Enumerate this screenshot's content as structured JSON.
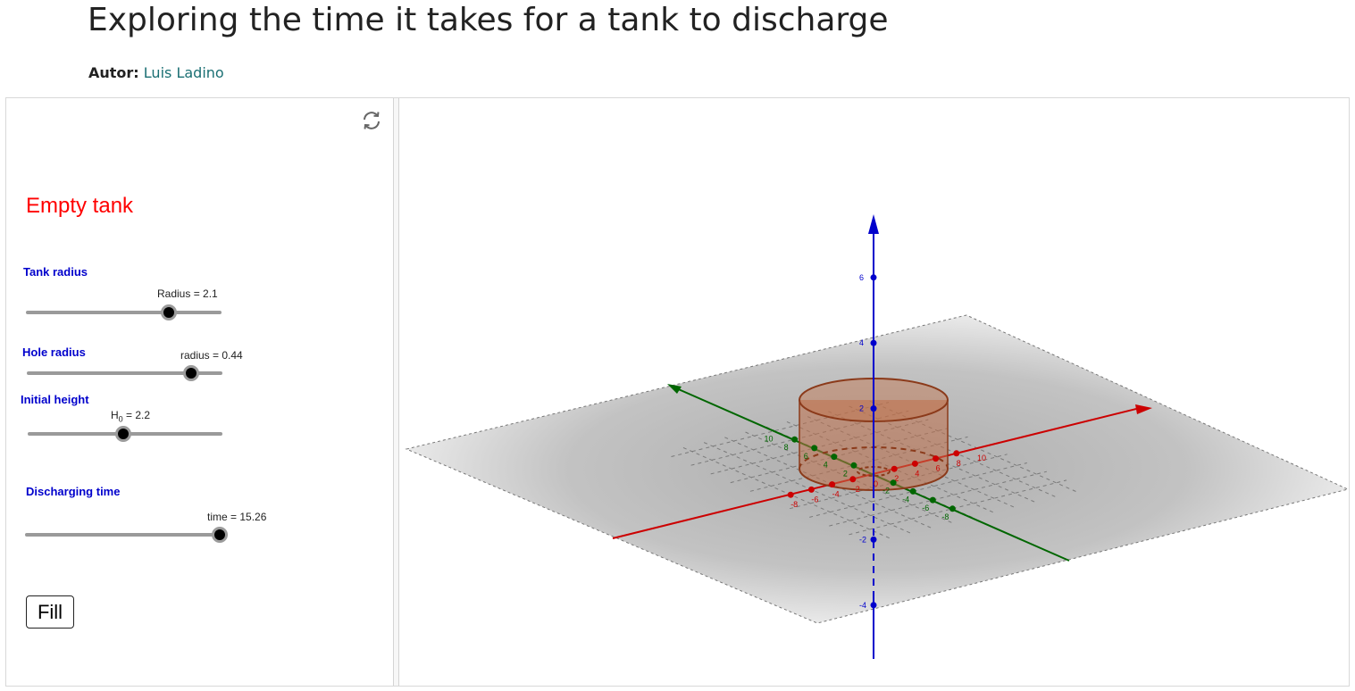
{
  "page": {
    "title": "Exploring the time it takes for a tank  to discharge",
    "author_label": "Autor:",
    "author_name": "Luis Ladino"
  },
  "panel": {
    "status_label": "Empty tank",
    "sliders": [
      {
        "section": "Tank radius",
        "caption": "Radius = 2.1",
        "position": 0.73
      },
      {
        "section": "Hole radius",
        "caption": "radius = 0.44",
        "position": 0.84
      },
      {
        "section": "Initial height",
        "caption_var": "H",
        "caption_sub": "0",
        "caption_rest": " = 2.2",
        "position": 0.49
      },
      {
        "section": "Discharging time",
        "caption": "time = 15.26",
        "position": 1.0
      }
    ],
    "fill_button": "Fill"
  },
  "view3d": {
    "axis_colors": {
      "x": "#cc0000",
      "y": "#006600",
      "z": "#0000cc"
    },
    "x_ticks": [
      "-8",
      "-6",
      "-4",
      "-2",
      "0",
      "2",
      "4",
      "6",
      "8",
      "10"
    ],
    "y_ticks": [
      "10",
      "8",
      "6",
      "4",
      "2",
      "-2",
      "-4",
      "-6",
      "-8"
    ],
    "z_ticks": [
      "6",
      "4",
      "2",
      "-2",
      "-4"
    ],
    "tank_color": "#c0704a"
  }
}
